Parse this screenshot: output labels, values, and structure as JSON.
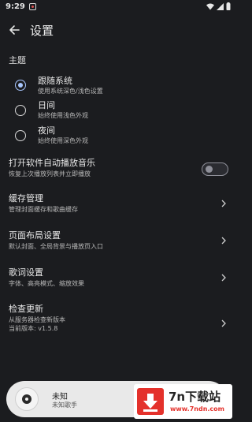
{
  "status_bar": {
    "time": "9:29"
  },
  "app_bar": {
    "title": "设置",
    "back_icon": "arrow-left-icon"
  },
  "theme": {
    "section_title": "主题",
    "options": [
      {
        "title": "跟随系统",
        "subtitle": "使用系统深色/浅色设置",
        "selected": true
      },
      {
        "title": "日间",
        "subtitle": "始终使用浅色外观",
        "selected": false
      },
      {
        "title": "夜间",
        "subtitle": "始终使用深色外观",
        "selected": false
      }
    ]
  },
  "autoplay": {
    "title": "打开软件自动播放音乐",
    "subtitle": "恢复上次播放列表并立即播放",
    "enabled": false
  },
  "settings": [
    {
      "title": "缓存管理",
      "subtitle": "管理封面缓存和歌曲缓存"
    },
    {
      "title": "页面布局设置",
      "subtitle": "默认封面、全局背景与播放页入口"
    },
    {
      "title": "歌词设置",
      "subtitle": "字体、高亮模式、缩放效果"
    },
    {
      "title": "检查更新",
      "subtitle": "从服务器检查新版本",
      "subtitle2": "当前版本: v1.5.8"
    }
  ],
  "mini_player": {
    "song": "未知",
    "artist": "未知歌手"
  },
  "watermark": {
    "brand": "7n下载站",
    "url": "www.7ndn.com"
  },
  "colors": {
    "background": "#1b1c1f",
    "accent": "#a9c7ff",
    "player_bg": "#e9e9e9",
    "watermark_red": "#e4312b"
  }
}
